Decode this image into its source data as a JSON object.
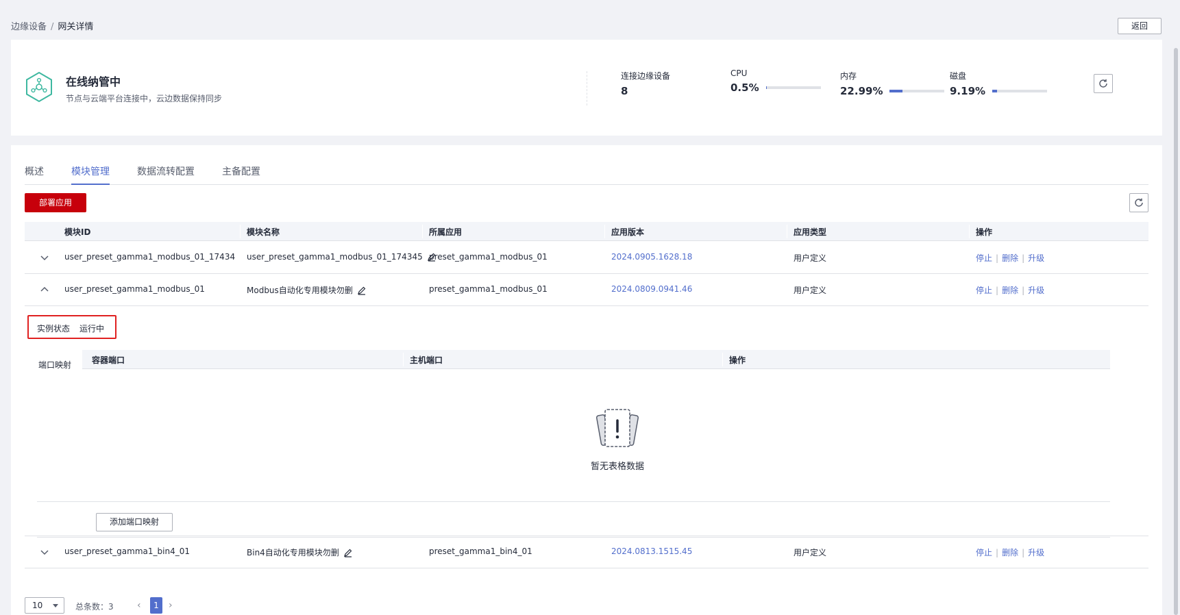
{
  "breadcrumb": {
    "parent": "边缘设备",
    "separator": "/",
    "current": "网关详情"
  },
  "back_label": "返回",
  "status": {
    "title": "在线纳管中",
    "subtitle": "节点与云端平台连接中，云边数据保持同步"
  },
  "stats": [
    {
      "label": "连接边缘设备",
      "value": "8"
    },
    {
      "label": "CPU",
      "value": "0.5%",
      "percent": 0.5
    },
    {
      "label": "内存",
      "value": "22.99%",
      "percent": 22.99
    },
    {
      "label": "磁盘",
      "value": "9.19%",
      "percent": 9.19
    }
  ],
  "tabs": [
    "概述",
    "模块管理",
    "数据流转配置",
    "主备配置"
  ],
  "active_tab": 1,
  "deploy_label": "部署应用",
  "table": {
    "headers": [
      "模块ID",
      "模块名称",
      "所属应用",
      "应用版本",
      "应用类型",
      "操作"
    ],
    "rows": [
      {
        "id": "user_preset_gamma1_modbus_01_174345...",
        "name": "user_preset_gamma1_modbus_01_174345",
        "app": "preset_gamma1_modbus_01",
        "version": "2024.0905.1628.18",
        "type": "用户定义",
        "expanded": false
      },
      {
        "id": "user_preset_gamma1_modbus_01",
        "name": "Modbus自动化专用模块勿删",
        "app": "preset_gamma1_modbus_01",
        "version": "2024.0809.0941.46",
        "type": "用户定义",
        "expanded": true
      },
      {
        "id": "user_preset_gamma1_bin4_01",
        "name": "Bin4自动化专用模块勿删",
        "app": "preset_gamma1_bin4_01",
        "version": "2024.0813.1515.45",
        "type": "用户定义",
        "expanded": false
      }
    ],
    "ops": [
      "停止",
      "删除",
      "升级"
    ]
  },
  "detail": {
    "instance_label": "实例状态",
    "instance_value": "运行中",
    "port_label": "端口映射",
    "port_headers": [
      "容器端口",
      "主机端口",
      "操作"
    ],
    "empty_text": "暂无表格数据",
    "add_port_label": "添加端口映射"
  },
  "pagination": {
    "page_size": "10",
    "total": "总条数：3",
    "current_page": "1"
  },
  "colors": {
    "accent": "#526ecc",
    "primary": "#c7000b",
    "status_icon": "#3eb8a0",
    "highlight_box": "#e02020"
  }
}
